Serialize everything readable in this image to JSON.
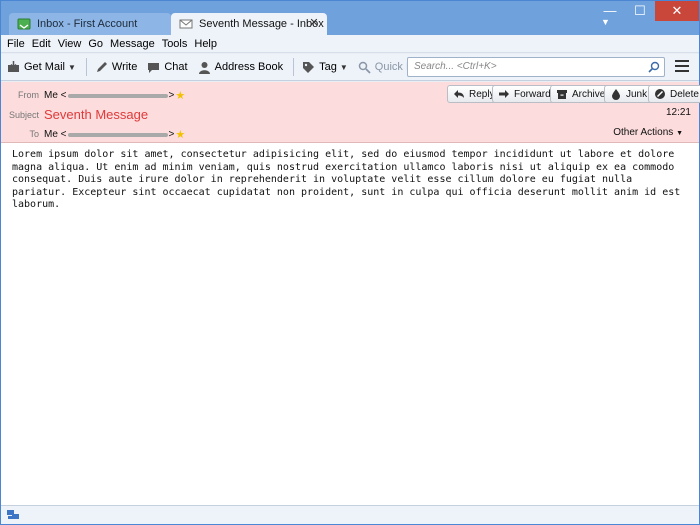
{
  "tabs": [
    {
      "label": "Inbox - First Account",
      "icon": "inbox-icon"
    },
    {
      "label": "Seventh Message - Inbox ...",
      "icon": "envelope-icon"
    }
  ],
  "window_controls": {
    "minimize": "—",
    "maximize": "☐",
    "close": "✕"
  },
  "menu": [
    "File",
    "Edit",
    "View",
    "Go",
    "Message",
    "Tools",
    "Help"
  ],
  "toolbar": {
    "get_mail": "Get Mail",
    "write": "Write",
    "chat": "Chat",
    "address_book": "Address Book",
    "tag": "Tag",
    "quick_filter": "Quick Filter",
    "search_placeholder": "Search... <Ctrl+K>"
  },
  "header": {
    "from_label": "From",
    "from_name": "Me <",
    "from_end": ">",
    "subject_label": "Subject",
    "subject": "Seventh Message",
    "to_label": "To",
    "to_name": "Me <",
    "to_end": ">",
    "time": "12:21",
    "other_actions": "Other Actions",
    "buttons": {
      "reply": "Reply",
      "forward": "Forward",
      "archive": "Archive",
      "junk": "Junk",
      "delete": "Delete"
    }
  },
  "body": "Lorem ipsum dolor sit amet, consectetur adipisicing elit, sed do eiusmod tempor incididunt ut labore et dolore magna aliqua. Ut enim ad minim veniam, quis nostrud exercitation ullamco laboris nisi ut aliquip ex ea commodo consequat. Duis aute irure dolor in reprehenderit in voluptate velit esse cillum dolore eu fugiat nulla pariatur. Excepteur sint occaecat cupidatat non proident, sunt in culpa qui officia deserunt mollit anim id est laborum."
}
